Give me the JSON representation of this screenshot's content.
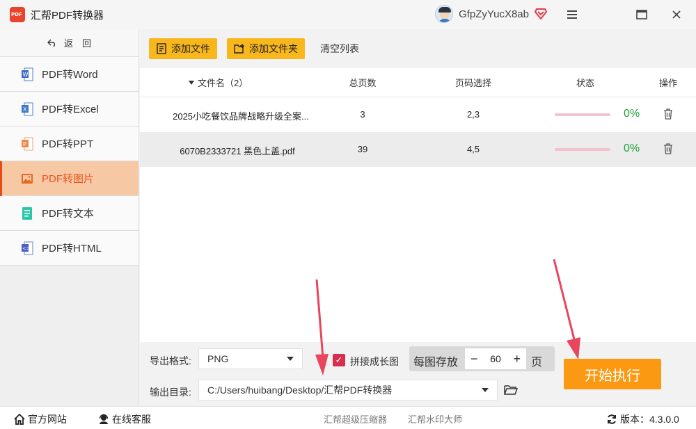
{
  "app": {
    "title": "汇帮PDF转换器",
    "username": "GfpZyYucX8ab"
  },
  "window": {
    "menu_icon": "hamburger-icon",
    "maximize_icon": "maximize-icon",
    "close_icon": "close-icon"
  },
  "sidebar": {
    "back_label": "返　回",
    "items": [
      {
        "label": "PDF转Word",
        "icon": "word-icon",
        "active": false
      },
      {
        "label": "PDF转Excel",
        "icon": "excel-icon",
        "active": false
      },
      {
        "label": "PDF转PPT",
        "icon": "ppt-icon",
        "active": false
      },
      {
        "label": "PDF转图片",
        "icon": "image-icon",
        "active": true
      },
      {
        "label": "PDF转文本",
        "icon": "text-icon",
        "active": false
      },
      {
        "label": "PDF转HTML",
        "icon": "html-icon",
        "active": false
      }
    ]
  },
  "toolbar": {
    "add_file": "添加文件",
    "add_folder": "添加文件夹",
    "clear_list": "清空列表"
  },
  "table": {
    "headers": {
      "filename": "文件名（2）",
      "pages": "总页数",
      "page_select": "页码选择",
      "status": "状态",
      "action": "操作"
    },
    "rows": [
      {
        "filename": "2025小吃餐饮品牌战略升级全案...",
        "pages": "3",
        "page_select": "2,3",
        "progress_text": "0%",
        "progress": 0
      },
      {
        "filename": "6070B2333721 黑色上盖.pdf",
        "pages": "39",
        "page_select": "4,5",
        "progress_text": "0%",
        "progress": 0
      }
    ]
  },
  "options": {
    "format_label": "导出格式:",
    "format_value": "PNG",
    "merge_label": "拼接成长图",
    "merge_checked": true,
    "per_image_label": "每图存放",
    "per_image_value": "60",
    "per_image_unit": "页",
    "minus": "−",
    "plus": "+",
    "output_label": "输出目录:",
    "output_path": "C:/Users/huibang/Desktop/汇帮PDF转换器",
    "start_label": "开始执行"
  },
  "footer": {
    "website": "官方网站",
    "service": "在线客服",
    "compress": "汇帮超级压缩器",
    "watermark": "汇帮水印大师",
    "version": "版本：4.3.0.0"
  },
  "colors": {
    "accent": "#f8b71c",
    "active_bg": "#f6c8a4",
    "start": "#fb9a12",
    "progress_ok": "#1ca33a",
    "arrow": "#e8465c"
  }
}
